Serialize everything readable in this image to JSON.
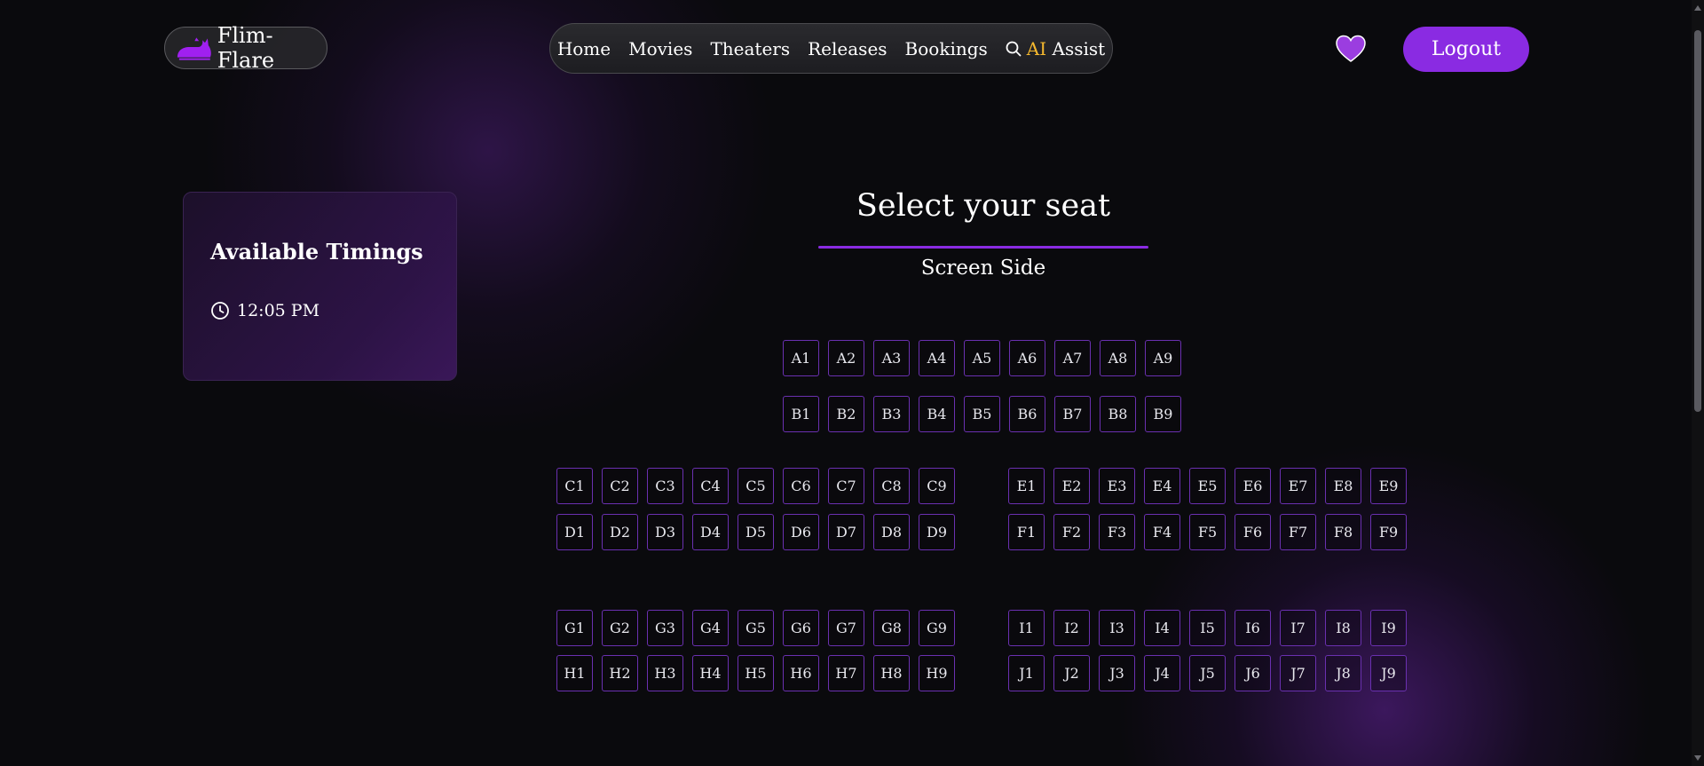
{
  "brand": {
    "name": "Flim-Flare",
    "accent": "#8a2be2"
  },
  "nav": {
    "items": [
      "Home",
      "Movies",
      "Theaters",
      "Releases",
      "Bookings"
    ],
    "ai_prefix": "AI",
    "ai_suffix": "Assist"
  },
  "header": {
    "logout_label": "Logout"
  },
  "timings": {
    "title": "Available Timings",
    "times": [
      "12:05 PM"
    ]
  },
  "seating": {
    "title": "Select your seat",
    "screen_label": "Screen Side",
    "rows": {
      "A": [
        "A1",
        "A2",
        "A3",
        "A4",
        "A5",
        "A6",
        "A7",
        "A8",
        "A9"
      ],
      "B": [
        "B1",
        "B2",
        "B3",
        "B4",
        "B5",
        "B6",
        "B7",
        "B8",
        "B9"
      ],
      "C": [
        "C1",
        "C2",
        "C3",
        "C4",
        "C5",
        "C6",
        "C7",
        "C8",
        "C9"
      ],
      "D": [
        "D1",
        "D2",
        "D3",
        "D4",
        "D5",
        "D6",
        "D7",
        "D8",
        "D9"
      ],
      "E": [
        "E1",
        "E2",
        "E3",
        "E4",
        "E5",
        "E6",
        "E7",
        "E8",
        "E9"
      ],
      "F": [
        "F1",
        "F2",
        "F3",
        "F4",
        "F5",
        "F6",
        "F7",
        "F8",
        "F9"
      ],
      "G": [
        "G1",
        "G2",
        "G3",
        "G4",
        "G5",
        "G6",
        "G7",
        "G8",
        "G9"
      ],
      "H": [
        "H1",
        "H2",
        "H3",
        "H4",
        "H5",
        "H6",
        "H7",
        "H8",
        "H9"
      ],
      "I": [
        "I1",
        "I2",
        "I3",
        "I4",
        "I5",
        "I6",
        "I7",
        "I8",
        "I9"
      ],
      "J": [
        "J1",
        "J2",
        "J3",
        "J4",
        "J5",
        "J6",
        "J7",
        "J8",
        "J9"
      ]
    }
  }
}
